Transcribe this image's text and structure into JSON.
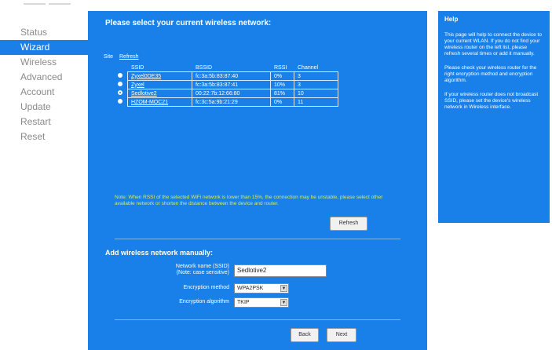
{
  "nav": {
    "items": [
      {
        "label": "Status",
        "active": false
      },
      {
        "label": "Wizard",
        "active": true
      },
      {
        "label": "Wireless",
        "active": false
      },
      {
        "label": "Advanced",
        "active": false
      },
      {
        "label": "Account",
        "active": false
      },
      {
        "label": "Update",
        "active": false
      },
      {
        "label": "Restart",
        "active": false
      },
      {
        "label": "Reset",
        "active": false
      }
    ]
  },
  "scan": {
    "title": "Please select your current wireless network:",
    "select_label": "Site",
    "refresh_link": "Refresh",
    "columns": [
      "SSID",
      "BSSID",
      "RSSI",
      "Channel"
    ],
    "rows": [
      {
        "ssid": "Zyxel0DE35",
        "bssid": "fc:3a:5b:83:87:40",
        "rssi": "0%",
        "channel": "3",
        "selected": false
      },
      {
        "ssid": "Zyxel",
        "bssid": "fc:3a:5b:83:87:41",
        "rssi": "10%",
        "channel": "3",
        "selected": false
      },
      {
        "ssid": "Sedlotive2",
        "bssid": "00:22:7b:12:66:80",
        "rssi": "81%",
        "channel": "10",
        "selected": true
      },
      {
        "ssid": "HZOM-MOC21",
        "bssid": "fc:3c:5a:9b:21:29",
        "rssi": "0%",
        "channel": "11",
        "selected": false
      }
    ],
    "note": "Note: When RSSI of the selected WiFi network is lower than 15%, the connection may be unstable, please select other available network or shorten the distance between the device and router.",
    "refresh_button": "Refresh"
  },
  "manual": {
    "title": "Add wireless network manually:",
    "ssid_label": "Network name (SSID)",
    "ssid_note": "(Note: case sensitive)",
    "ssid_value": "Sedlotive2",
    "method_label": "Encryption method",
    "method_value": "WPA2PSK",
    "algorithm_label": "Encryption algorithm",
    "algorithm_value": "TKIP"
  },
  "footer": {
    "back": "Back",
    "next": "Next"
  },
  "help": {
    "title": "Help",
    "paragraphs": [
      "This page will help to connect the device to your current WLAN. If you do not find your wireless router on the left list, please refresh several times or add it manually.",
      "Please check your wireless router for the right encryption method and encryption algorithm.",
      "If your wireless router does not broadcast SSID, please set the device's wireless network in Wireless interface."
    ]
  },
  "colors": {
    "panel_blue": "#1880e8",
    "nav_active": "#1a7fe6",
    "note_yellow": "#d6e96a"
  }
}
